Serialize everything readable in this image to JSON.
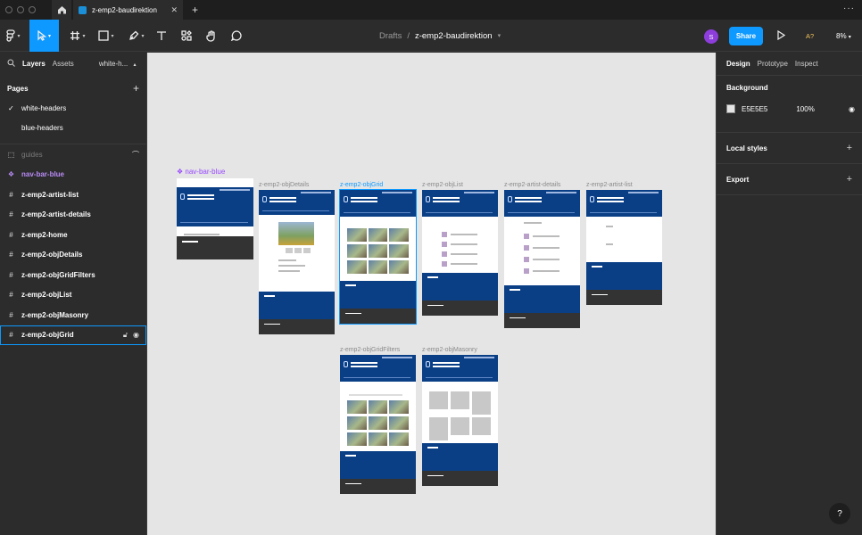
{
  "titlebar": {
    "file_tab": "z-emp2-baudirektion",
    "new_tab_icon": "plus-icon",
    "more_icon": "ellipsis-icon",
    "more": "···"
  },
  "toolbar": {
    "breadcrumb_project": "Drafts",
    "breadcrumb_sep": "/",
    "file_name": "z-emp2-baudirektion",
    "avatar_initial": "S",
    "share_label": "Share",
    "a11y_label": "A?",
    "zoom_label": "8%",
    "accent_color": "#0d99ff"
  },
  "left_panel": {
    "tabs": [
      "Layers",
      "Assets"
    ],
    "page_selector": "white-h...",
    "pages_title": "Pages",
    "pages": [
      {
        "name": "white-headers",
        "active": true
      },
      {
        "name": "blue-headers",
        "active": false
      }
    ],
    "layers": [
      {
        "name": "guides",
        "kind": "guides"
      },
      {
        "name": "nav-bar-blue",
        "kind": "component"
      },
      {
        "name": "z-emp2-artist-list",
        "kind": "frame"
      },
      {
        "name": "z-emp2-artist-details",
        "kind": "frame"
      },
      {
        "name": "z-emp2-home",
        "kind": "frame"
      },
      {
        "name": "z-emp2-objDetails",
        "kind": "frame"
      },
      {
        "name": "z-emp2-objGridFilters",
        "kind": "frame"
      },
      {
        "name": "z-emp2-objList",
        "kind": "frame"
      },
      {
        "name": "z-emp2-objMasonry",
        "kind": "frame"
      },
      {
        "name": "z-emp2-objGrid",
        "kind": "frame",
        "selected": true
      }
    ]
  },
  "canvas": {
    "background": "#e5e5e5",
    "component_label": "❖ nav-bar-blue",
    "frames": [
      {
        "label": "z-emp2-home"
      },
      {
        "label": "z-emp2-objDetails"
      },
      {
        "label": "z-emp2-objGrid",
        "selected": true
      },
      {
        "label": "z-emp2-objList"
      },
      {
        "label": "z-emp2-artist-details"
      },
      {
        "label": "z-emp2-artist-list"
      },
      {
        "label": "z-emp2-objGridFilters"
      },
      {
        "label": "z-emp2-objMasonry"
      }
    ]
  },
  "right_panel": {
    "tabs": [
      "Design",
      "Prototype",
      "Inspect"
    ],
    "background_title": "Background",
    "background_hex": "E5E5E5",
    "background_opacity": "100%",
    "local_styles_title": "Local styles",
    "export_title": "Export"
  },
  "help": "?"
}
